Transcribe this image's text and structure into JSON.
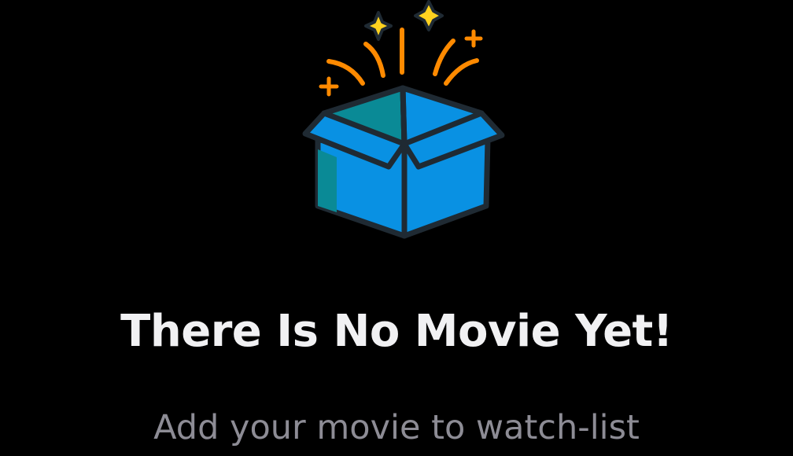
{
  "empty_state": {
    "illustration_icon": "open-box-icon",
    "title": "There Is No Movie Yet!",
    "subtitle": "Add your movie to watch-list"
  },
  "colors": {
    "background": "#000000",
    "title": "#f1f1f3",
    "subtitle": "#8d8c95",
    "box_blue": "#0991e3",
    "box_teal": "#0a8a96",
    "box_outline": "#1f2a33",
    "burst_orange": "#ff8a00",
    "sparkle_yellow": "#ffd21f"
  }
}
